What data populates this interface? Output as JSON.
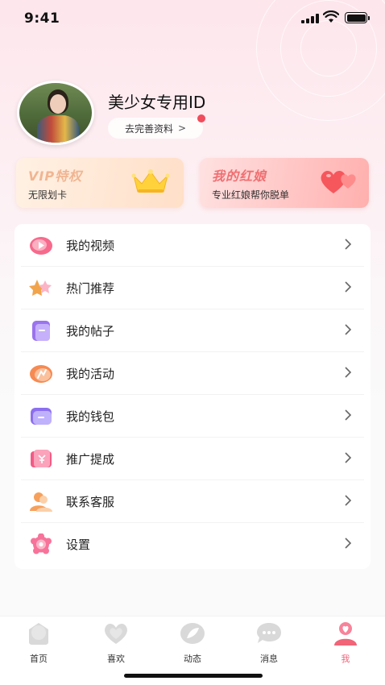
{
  "status_bar": {
    "time": "9:41"
  },
  "profile": {
    "name": "美少女专用ID",
    "edit_label": "去完善资料",
    "edit_chevron": ">"
  },
  "cards": {
    "vip": {
      "title": "VIP特权",
      "subtitle": "无限划卡",
      "icon": "crown-icon"
    },
    "matchmaker": {
      "title": "我的红娘",
      "subtitle": "专业红娘帮你脱单",
      "icon": "hearts-icon"
    }
  },
  "menu": {
    "items": [
      {
        "label": "我的视频",
        "icon": "video-icon"
      },
      {
        "label": "热门推荐",
        "icon": "star-icon"
      },
      {
        "label": "我的帖子",
        "icon": "post-icon"
      },
      {
        "label": "我的活动",
        "icon": "activity-icon"
      },
      {
        "label": "我的钱包",
        "icon": "wallet-icon"
      },
      {
        "label": "推广提成",
        "icon": "commission-icon"
      },
      {
        "label": "联系客服",
        "icon": "customer-service-icon"
      },
      {
        "label": "设置",
        "icon": "settings-icon"
      }
    ]
  },
  "tabbar": {
    "tabs": [
      {
        "label": "首页",
        "icon": "home-icon"
      },
      {
        "label": "喜欢",
        "icon": "heart-icon"
      },
      {
        "label": "动态",
        "icon": "feed-icon"
      },
      {
        "label": "消息",
        "icon": "message-icon"
      },
      {
        "label": "我",
        "icon": "profile-icon",
        "active": true
      }
    ]
  },
  "colors": {
    "accent": "#f26478",
    "vip_title": "#f0b592",
    "match_title": "#ef6f72",
    "notification_dot": "#f04c5c"
  }
}
